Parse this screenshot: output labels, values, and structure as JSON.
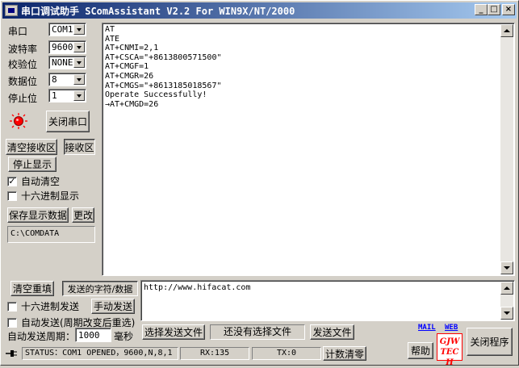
{
  "window": {
    "title": "串口调试助手 SComAssistant V2.2 For WIN9X/NT/2000",
    "min_label": "_",
    "max_label": "□",
    "close_label": "×"
  },
  "settings": {
    "port_label": "串口",
    "port_value": "COM1",
    "baud_label": "波特率",
    "baud_value": "9600",
    "parity_label": "校验位",
    "parity_value": "NONE",
    "databits_label": "数据位",
    "databits_value": "8",
    "stopbits_label": "停止位",
    "stopbits_value": "1"
  },
  "controls": {
    "close_port": "关闭串口",
    "clear_recv": "清空接收区",
    "recv_area": "接收区",
    "stop_display": "停止显示",
    "auto_clear": "自动清空",
    "auto_clear_checked": "✓",
    "hex_display": "十六进制显示",
    "save_data": "保存显示数据",
    "change": "更改",
    "save_path": "C:\\COMDATA"
  },
  "receive": {
    "lines": [
      "AT",
      "ATE",
      "AT+CNMI=2,1",
      "AT+CSCA=\"+8613800571500\"",
      "AT+CMGF=1",
      "AT+CMGR=26",
      "AT+CMGS=\"+8613185018567\"",
      "Operate Successfully!",
      "→AT+CMGD=26"
    ]
  },
  "send": {
    "clear_resend": "清空重填",
    "send_chars": "发送的字符/数据",
    "hex_send": "十六进制发送",
    "manual_send": "手动发送",
    "auto_send": "自动发送(周期改变后重选)",
    "period_label": "自动发送周期：",
    "period_value": "1000",
    "period_unit": "毫秒",
    "text": "http://www.hifacat.com",
    "choose_file": "选择发送文件",
    "no_file": "还没有选择文件",
    "send_file": "发送文件",
    "mail": "MAIL",
    "web": "WEB",
    "help": "帮助",
    "logo": "GJW TECH",
    "close_app": "关闭程序"
  },
  "status": {
    "text": "STATUS：COM1 OPENED，9600,N,8,1",
    "rx": "RX:135",
    "tx": "TX:0",
    "reset_count": "计数清零"
  },
  "colors": {
    "title_start": "#0a246a",
    "title_end": "#a6caf0",
    "indicator": "#ff0000",
    "link": "#0000ff"
  }
}
